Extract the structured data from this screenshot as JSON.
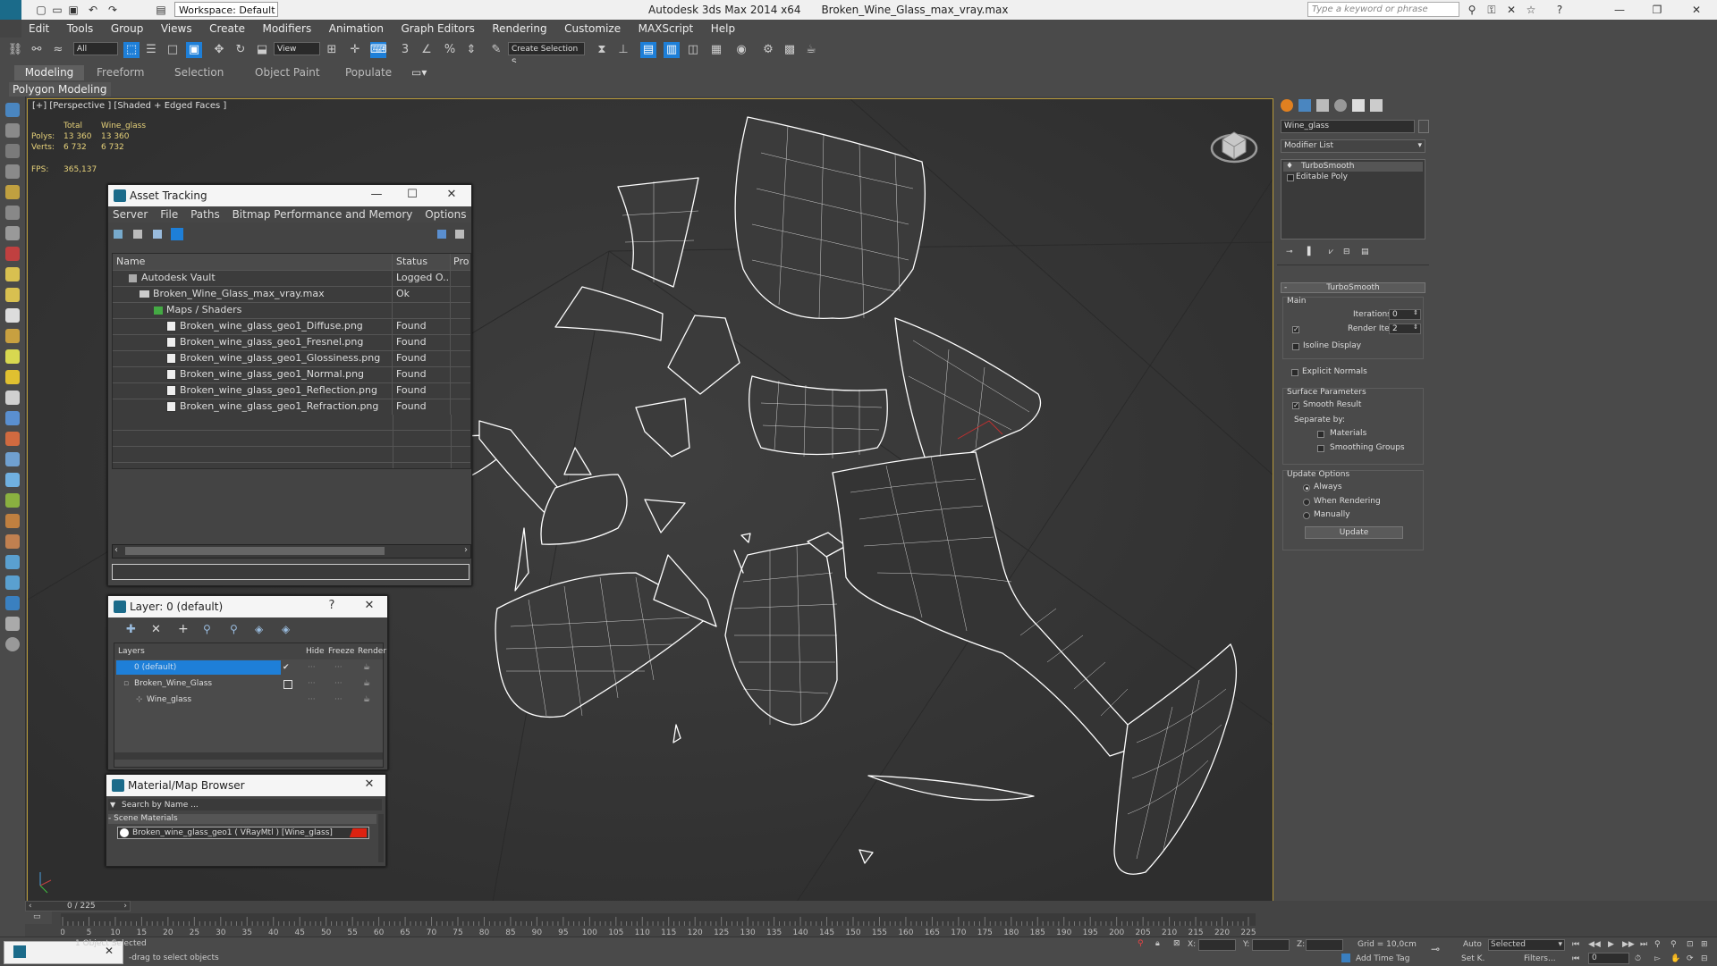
{
  "window": {
    "app_title": "Autodesk 3ds Max  2014 x64",
    "file_title": "Broken_Wine_Glass_max_vray.max",
    "workspace": "Workspace: Default",
    "search_placeholder": "Type a keyword or phrase"
  },
  "menu": [
    "Edit",
    "Tools",
    "Group",
    "Views",
    "Create",
    "Modifiers",
    "Animation",
    "Graph Editors",
    "Rendering",
    "Customize",
    "MAXScript",
    "Help"
  ],
  "toolbar": {
    "selection_filter": "All",
    "ref_coord": "View",
    "named_selection": "Create Selection S"
  },
  "ribbon": {
    "tabs": [
      "Modeling",
      "Freeform",
      "Selection",
      "Object Paint",
      "Populate"
    ],
    "sub_label": "Polygon Modeling"
  },
  "viewport": {
    "label": "[+] [Perspective ] [Shaded + Edged Faces ]",
    "stats": {
      "col_total": "Total",
      "col_object": "Wine_glass",
      "polys_label": "Polys:",
      "polys_total": "13 360",
      "polys_obj": "13 360",
      "verts_label": "Verts:",
      "verts_total": "6 732",
      "verts_obj": "6 732",
      "fps_label": "FPS:",
      "fps_value": "365,137"
    }
  },
  "asset_tracking": {
    "title": "Asset Tracking",
    "menu": [
      "Server",
      "File",
      "Paths",
      "Bitmap Performance and Memory",
      "Options"
    ],
    "columns": [
      "Name",
      "Status",
      "Pro"
    ],
    "rows": [
      {
        "name": "Autodesk Vault",
        "status": "Logged O..."
      },
      {
        "name": "Broken_Wine_Glass_max_vray.max",
        "status": "Ok"
      },
      {
        "name": "Maps / Shaders",
        "status": ""
      },
      {
        "name": "Broken_wine_glass_geo1_Diffuse.png",
        "status": "Found"
      },
      {
        "name": "Broken_wine_glass_geo1_Fresnel.png",
        "status": "Found"
      },
      {
        "name": "Broken_wine_glass_geo1_Glossiness.png",
        "status": "Found"
      },
      {
        "name": "Broken_wine_glass_geo1_Normal.png",
        "status": "Found"
      },
      {
        "name": "Broken_wine_glass_geo1_Reflection.png",
        "status": "Found"
      },
      {
        "name": "Broken_wine_glass_geo1_Refraction.png",
        "status": "Found"
      }
    ]
  },
  "layer_window": {
    "title": "Layer: 0 (default)",
    "help": "?",
    "columns": [
      "Layers",
      "Hide",
      "Freeze",
      "Render"
    ],
    "rows": [
      {
        "name": "0 (default)"
      },
      {
        "name": "Broken_Wine_Glass"
      },
      {
        "name": "Wine_glass"
      }
    ]
  },
  "material_browser": {
    "title": "Material/Map Browser",
    "search_placeholder": "Search by Name ...",
    "section": "- Scene Materials",
    "item": "Broken_wine_glass_geo1 ( VRayMtl ) [Wine_glass]"
  },
  "command_panel": {
    "object_name": "Wine_glass",
    "modifier_list": "Modifier List",
    "stack": [
      "TurboSmooth",
      "Editable Poly"
    ],
    "rollout_title": "TurboSmooth",
    "main_label": "Main",
    "iterations_label": "Iterations:",
    "iterations_value": "0",
    "render_iters_label": "Render Iters:",
    "render_iters_value": "2",
    "isoline_display": "Isoline Display",
    "explicit_normals": "Explicit Normals",
    "surface_params": "Surface Parameters",
    "smooth_result": "Smooth Result",
    "separate_by": "Separate by:",
    "materials": "Materials",
    "smoothing_groups": "Smoothing Groups",
    "update_options": "Update Options",
    "always": "Always",
    "when_rendering": "When Rendering",
    "manually": "Manually",
    "update_button": "Update"
  },
  "timeline": {
    "frame_counter": "0 / 225",
    "ticks": [
      "0",
      "5",
      "10",
      "15",
      "20",
      "25",
      "30",
      "35",
      "40",
      "45",
      "50",
      "55",
      "60",
      "65",
      "70",
      "75",
      "80",
      "85",
      "90",
      "95",
      "100",
      "105",
      "110",
      "115",
      "120",
      "125",
      "130",
      "135",
      "140",
      "145",
      "150",
      "155",
      "160",
      "165",
      "170",
      "175",
      "180",
      "185",
      "190",
      "195",
      "200",
      "205",
      "210",
      "215",
      "220",
      "225"
    ],
    "max_frame": 225
  },
  "statusbar": {
    "selected_text": "1 Object Selected",
    "prompt": "-drag to select objects",
    "x_label": "X:",
    "y_label": "Y:",
    "z_label": "Z:",
    "grid": "Grid = 10,0cm",
    "add_time_tag": "Add Time Tag",
    "auto": "Auto",
    "set_k": "Set K.",
    "selected_dropdown": "Selected",
    "filters": "Filters...",
    "frame": "0"
  },
  "colors": {
    "viewport_bg": "#3a3a3a",
    "ui_bg": "#4a4a4a",
    "selection_blue": "#1e7fd8",
    "stats_yellow": "#e7d27a",
    "wire_white": "#ffffff"
  }
}
